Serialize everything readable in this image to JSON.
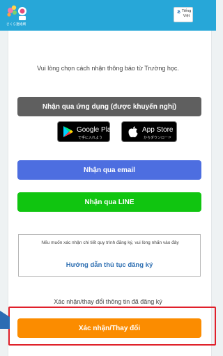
{
  "header": {
    "logo_text": "さくら連絡網",
    "language_button": "Tiếng Việt"
  },
  "main": {
    "instruction": "Vui lòng chọn cách nhận thông báo từ Trường học.",
    "app_button": "Nhận qua ứng dụng (được khuyến nghị)",
    "google_play": {
      "main": "Google Play",
      "sub": "で手に入れよう"
    },
    "app_store": {
      "main": "App Store",
      "sub": "からダウンロード"
    },
    "email_button": "Nhận qua email",
    "line_button": "Nhận qua LINE",
    "info_box": {
      "text": "Nếu muốn xác nhận chi tiết quy trình đăng ký, vui lòng nhấn vào đây",
      "link": "Hướng dẫn thủ tục đăng ký"
    },
    "confirm_caption": "Xác nhận/thay đổi thông tin đã đăng ký",
    "confirm_button": "Xác nhận/Thay đổi"
  },
  "colors": {
    "header": "#27a7d8",
    "app_button": "#5f5f5f",
    "email_button": "#4d6ee0",
    "line_button": "#10c510",
    "confirm_button": "#fb8c00",
    "highlight": "#e0202a",
    "link": "#2e6fb2"
  }
}
